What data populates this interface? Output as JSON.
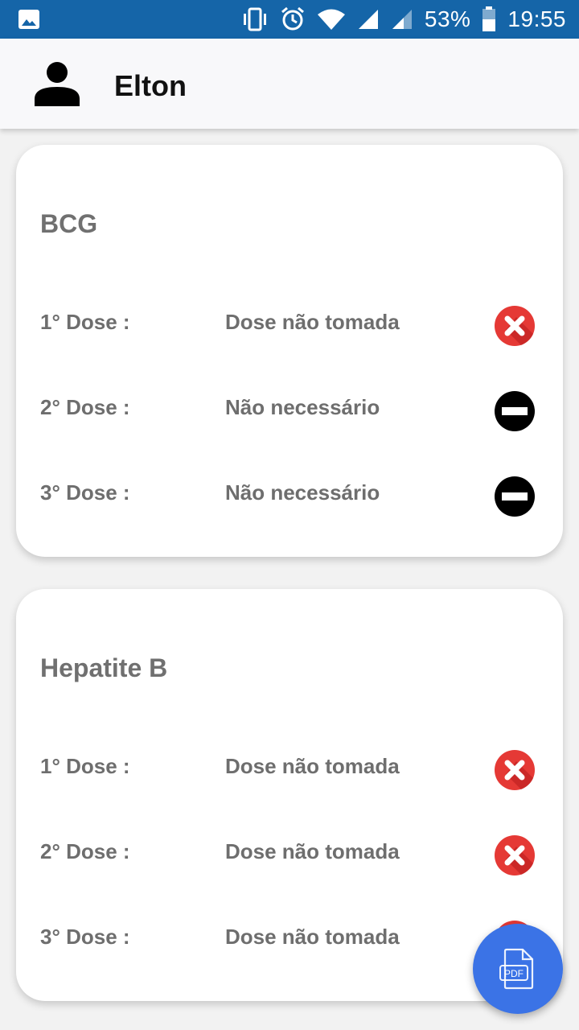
{
  "status_bar": {
    "battery": "53%",
    "time": "19:55",
    "icons": [
      "image-icon",
      "vibrate-icon",
      "alarm-icon",
      "wifi-icon",
      "signal-icon",
      "signal-icon-2",
      "battery-icon"
    ]
  },
  "header": {
    "user_name": "Elton",
    "avatar_icon": "person-icon"
  },
  "vaccines": [
    {
      "name": "BCG",
      "doses": [
        {
          "label": "1° Dose :",
          "status": "Dose não tomada",
          "icon": "red-x-icon"
        },
        {
          "label": "2° Dose :",
          "status": "Não necessário",
          "icon": "not-required-icon"
        },
        {
          "label": "3° Dose :",
          "status": "Não necessário",
          "icon": "not-required-icon"
        }
      ]
    },
    {
      "name": "Hepatite B",
      "doses": [
        {
          "label": "1° Dose :",
          "status": "Dose não tomada",
          "icon": "red-x-icon"
        },
        {
          "label": "2° Dose :",
          "status": "Dose não tomada",
          "icon": "red-x-icon"
        },
        {
          "label": "3° Dose :",
          "status": "Dose não tomada",
          "icon": "red-x-icon"
        }
      ]
    }
  ],
  "fab": {
    "label": "PDF",
    "icon": "pdf-file-icon",
    "color": "#3b73e6"
  },
  "colors": {
    "status_bar": "#1565a8",
    "not_taken": "#e53935",
    "not_required": "#000000"
  }
}
